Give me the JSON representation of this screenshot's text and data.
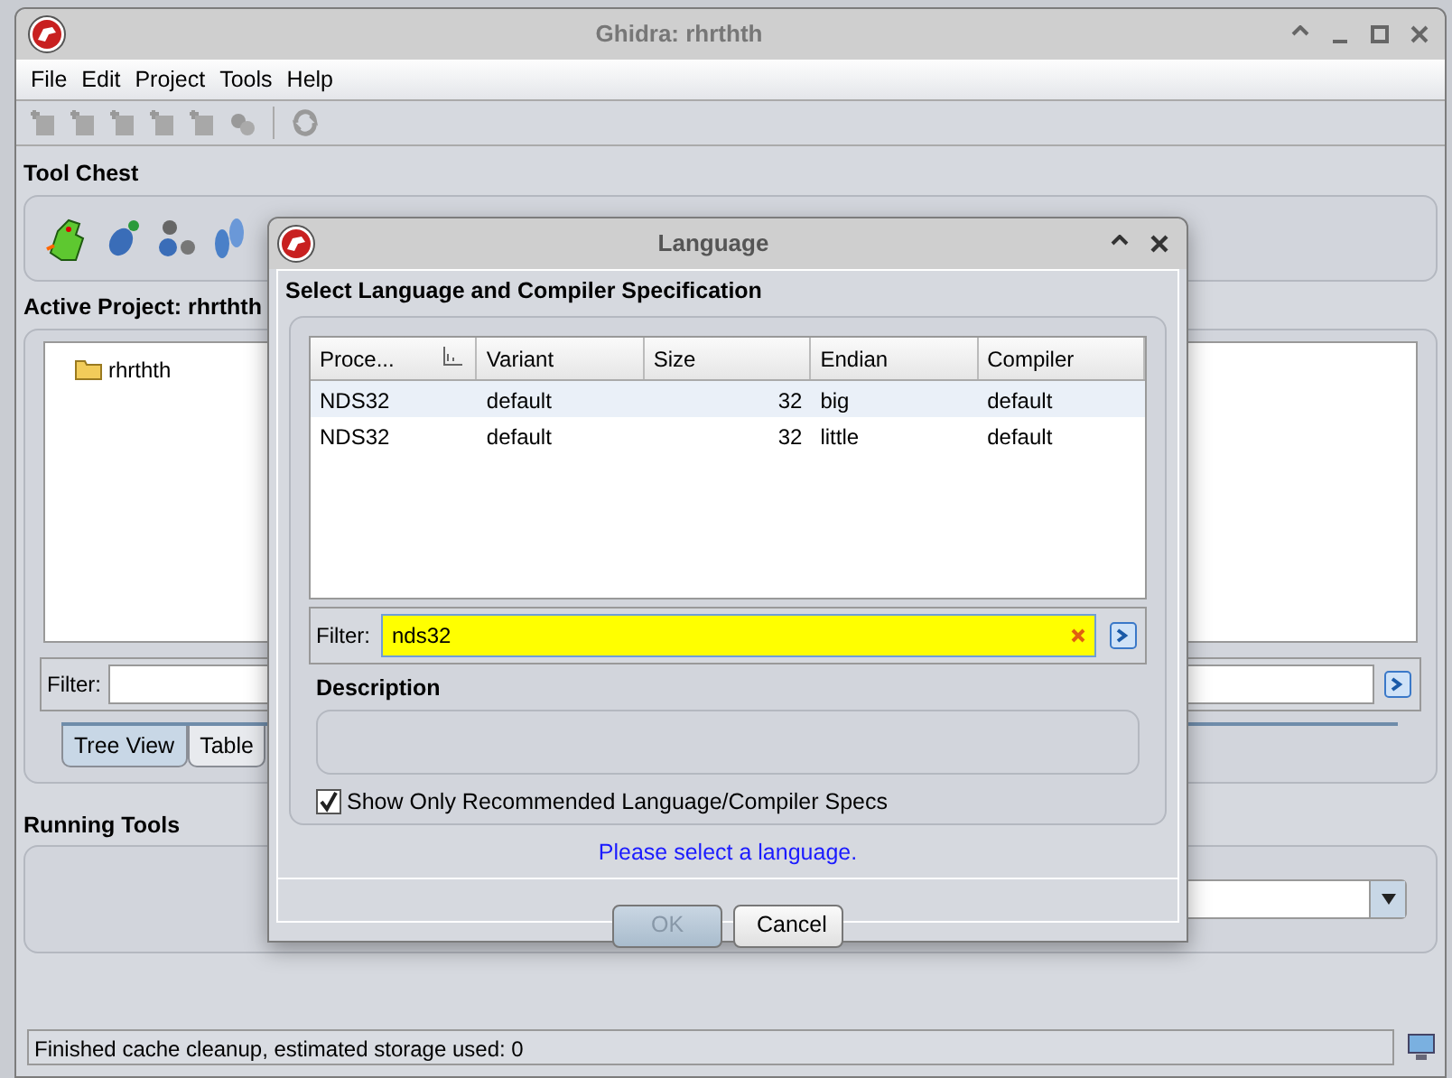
{
  "window": {
    "title": "Ghidra: rhrthth"
  },
  "menu": [
    "File",
    "Edit",
    "Project",
    "Tools",
    "Help"
  ],
  "tool_chest": {
    "title": "Tool Chest"
  },
  "project": {
    "title": "Active Project: rhrthth",
    "tree": [
      {
        "label": "rhrthth"
      }
    ],
    "filter_label": "Filter:",
    "tabs": [
      {
        "label": "Tree View",
        "selected": true
      },
      {
        "label": "Table",
        "selected": false
      }
    ]
  },
  "running_tools": {
    "title": "Running Tools"
  },
  "status_bar": "Finished cache cleanup, estimated storage used: 0",
  "dialog": {
    "title": "Language",
    "heading": "Select Language and Compiler Specification",
    "table": {
      "columns": [
        "Proce...",
        "Variant",
        "Size",
        "Endian",
        "Compiler"
      ],
      "rows": [
        {
          "cells": [
            "NDS32",
            "default",
            "32",
            "big",
            "default"
          ],
          "selected": true
        },
        {
          "cells": [
            "NDS32",
            "default",
            "32",
            "little",
            "default"
          ],
          "selected": false
        }
      ]
    },
    "filter": {
      "label": "Filter:",
      "value": "nds32"
    },
    "description": {
      "title": "Description"
    },
    "recommended": {
      "label": "Show Only Recommended Language/Compiler Specs",
      "checked": true
    },
    "message": "Please select a language.",
    "buttons": [
      {
        "label": "OK",
        "disabled": true
      },
      {
        "label": "Cancel",
        "disabled": false
      }
    ]
  }
}
